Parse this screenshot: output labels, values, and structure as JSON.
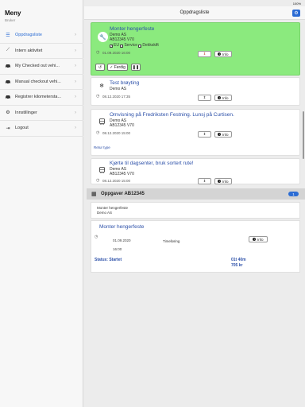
{
  "status_bar": {
    "time": "11:38 AM   Tue Dec 8",
    "battery": "100%"
  },
  "sidebar": {
    "title": "Meny",
    "subtitle": "Bruker",
    "items": [
      {
        "label": "Oppdragsliste",
        "icon": "list-icon"
      },
      {
        "label": "Intern aktivitet",
        "icon": "activity-icon"
      },
      {
        "label": "My Checked out vehi...",
        "icon": "car-icon"
      },
      {
        "label": "Manual checkout vehi...",
        "icon": "car-icon"
      },
      {
        "label": "Registrer kilometersta...",
        "icon": "car-icon"
      },
      {
        "label": "Innstillinger",
        "icon": "users-gear-icon"
      },
      {
        "label": "Logout",
        "icon": "logout-icon"
      }
    ]
  },
  "header": {
    "title": "Oppdragsliste",
    "config_icon": "gear-icon"
  },
  "tasks": [
    {
      "title": "Monter hengerfeste",
      "customer": "Demo AS",
      "vehicle": "AB12345 V70",
      "checks": [
        "EU",
        "Service",
        "Dekkskift"
      ],
      "date": "01.09.2020 16:00",
      "info_label": "Info",
      "ferdig_label": "Ferdig",
      "highlight_color": "#8bea7e"
    },
    {
      "title": "Test brøyting",
      "customer": "Demo AS",
      "date": "08.12.2020 17:35",
      "info_label": "Info"
    },
    {
      "title": "Omvisning på Fredriksten Festning. Lunsj på Curtisen.",
      "customer": "Demo AS",
      "vehicle": "AB12345 V70",
      "date": "08.12.2020 15:00",
      "info_label": "Info",
      "retur_label": "Retur type"
    },
    {
      "title": "Kjørte til dagsenter, bruk sortert rute!",
      "customer": "Demo AS",
      "vehicle": "AB12345 V70",
      "date": "08.12.2020 15:00",
      "info_label": "Info"
    }
  ],
  "oppgaver": {
    "label": "Oppgaver  AB12345",
    "badge": "1",
    "sub_line1": "Monter hengerfeste",
    "sub_line2": "Demo AS"
  },
  "detail": {
    "title": "Monter hengerfeste",
    "date": "01.09.2020",
    "time": "16:00",
    "registration": "Timeføring",
    "info_label": "Info",
    "status": "Status:  Startet",
    "duration": "01t 40m",
    "price": "705  kr"
  },
  "colors": {
    "accent": "#2b6cd4",
    "title_text": "#2b4fa8",
    "highlight": "#8bea7e"
  }
}
